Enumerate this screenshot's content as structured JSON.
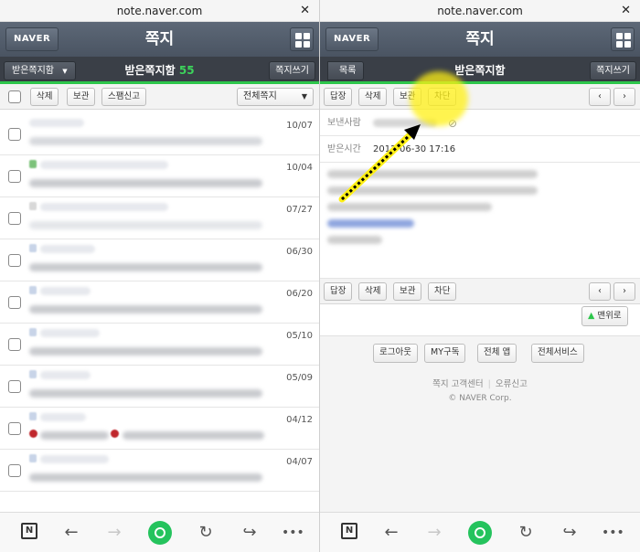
{
  "left": {
    "url": "note.naver.com",
    "logo": "NAVER",
    "title": "쪽지",
    "folder_select": "받은쪽지함",
    "inbox_title": "받은쪽지함",
    "inbox_count": "55",
    "write_button": "쪽지쓰기",
    "toolbar": {
      "delete": "삭제",
      "keep": "보관",
      "spam": "스팸신고",
      "filter": "전체쪽지"
    },
    "messages": [
      {
        "date": "10/07"
      },
      {
        "date": "10/04"
      },
      {
        "date": "07/27"
      },
      {
        "date": "06/30"
      },
      {
        "date": "06/20"
      },
      {
        "date": "05/10"
      },
      {
        "date": "05/09"
      },
      {
        "date": "04/12"
      },
      {
        "date": "04/07"
      }
    ]
  },
  "right": {
    "url": "note.naver.com",
    "logo": "NAVER",
    "title": "쪽지",
    "list_button": "목록",
    "inbox_title": "받은쪽지함",
    "write_button": "쪽지쓰기",
    "actions": {
      "reply": "답장",
      "delete": "삭제",
      "keep": "보관",
      "block": "차단"
    },
    "sender_label": "보낸사람",
    "received_label": "받은시간",
    "received_time": "2012-06-30 17:16",
    "top_button": "맨위로",
    "footer_buttons": [
      "로그아웃",
      "MY구독",
      "전체 앱",
      "전체서비스"
    ],
    "footer_links": [
      "쪽지 고객센터",
      "오류신고"
    ],
    "copyright": "© NAVER Corp."
  },
  "colors": {
    "accent_green": "#2dc64b",
    "highlight": "#fff014",
    "arrow": "#000000"
  },
  "icons": [
    "close-icon",
    "grid-icon",
    "chevron-down-icon",
    "chevron-left-icon",
    "chevron-right-icon",
    "block-user-icon",
    "arrow-up-icon",
    "naver-n-icon",
    "back-icon",
    "forward-icon",
    "home-icon",
    "refresh-icon",
    "share-icon",
    "more-icon"
  ]
}
